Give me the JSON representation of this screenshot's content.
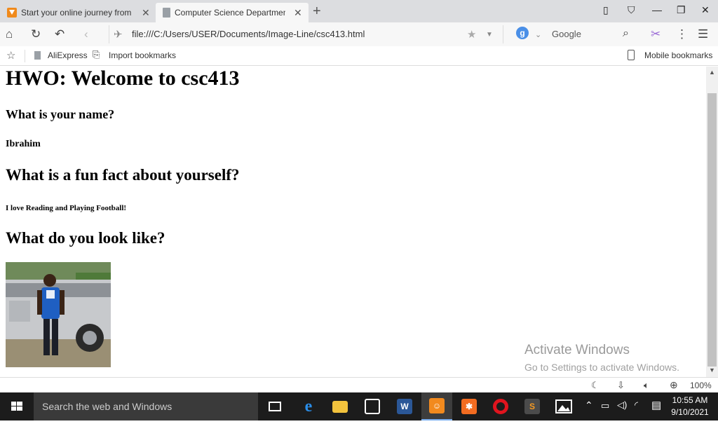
{
  "tabs": [
    {
      "title": "Start your online journey from",
      "favicon": "orange-play-icon",
      "active": false
    },
    {
      "title": "Computer Science Departmen",
      "favicon": "document-icon",
      "active": true
    }
  ],
  "navbar": {
    "url": "file:///C:/Users/USER/Documents/Image-Line/csc413.html",
    "search_placeholder": "Google",
    "search_engine_letter": "g"
  },
  "bookmarks": {
    "items": [
      "AliExpress",
      "Import bookmarks"
    ],
    "mobile": "Mobile bookmarks"
  },
  "page": {
    "heading": "HWO: Welcome to csc413",
    "q_name": "What is your name?",
    "a_name": "Ibrahim",
    "q_fact": "What is a fun fact about yourself?",
    "a_fact": "I love Reading and Playing Football!",
    "q_look": "What do you look like?"
  },
  "watermark": {
    "line1": "Activate Windows",
    "line2": "Go to Settings to activate Windows."
  },
  "statusbar": {
    "zoom": "100%"
  },
  "taskbar": {
    "search_placeholder": "Search the web and Windows",
    "apps": [
      {
        "name": "task-view",
        "letter": ""
      },
      {
        "name": "edge",
        "letter": "e",
        "color": "#1e78d7"
      },
      {
        "name": "file-explorer",
        "letter": "",
        "color": "#f3c33d"
      },
      {
        "name": "store",
        "letter": "",
        "color": "#ffffff"
      },
      {
        "name": "word",
        "letter": "W",
        "color": "#2b5797"
      },
      {
        "name": "uc-browser",
        "letter": "",
        "color": "#f28a1e",
        "active": true
      },
      {
        "name": "xampp",
        "letter": "",
        "color": "#f36c21"
      },
      {
        "name": "opera",
        "letter": "O",
        "color": "#e0141e"
      },
      {
        "name": "sublime",
        "letter": "S",
        "color": "#4b4b4b"
      },
      {
        "name": "photos",
        "letter": "",
        "color": "#ffffff"
      }
    ],
    "time": "10:55 AM",
    "date": "9/10/2021"
  }
}
